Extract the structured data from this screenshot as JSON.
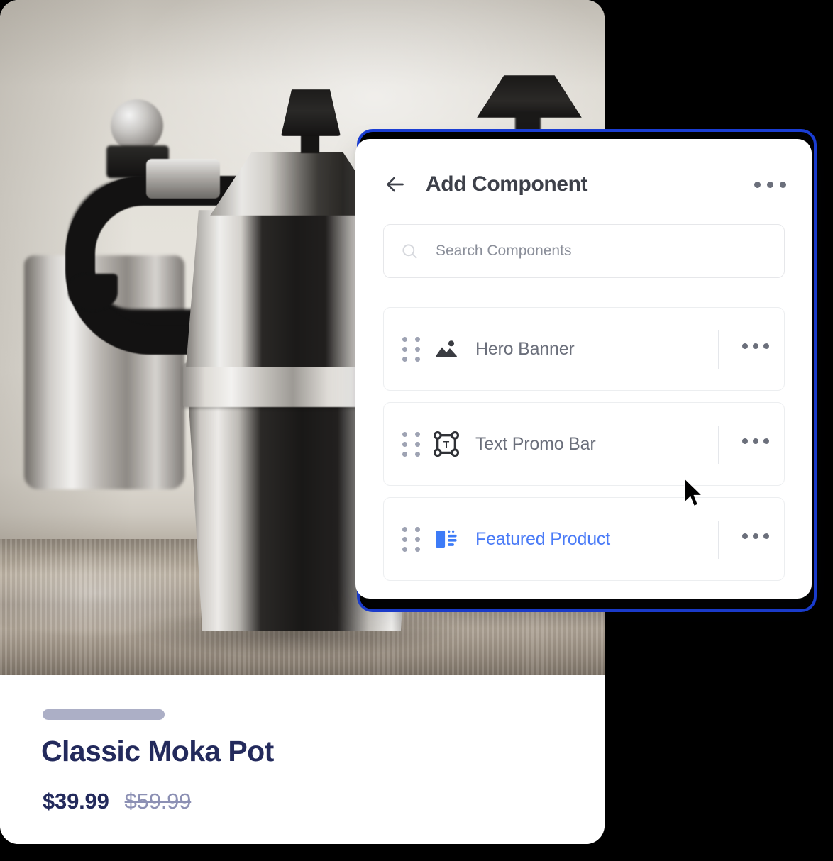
{
  "product_card": {
    "photo_alt": "Classic stovetop moka pot on a kitchen counter",
    "placeholder_bar": "",
    "title": "Classic Moka Pot",
    "price_current": "$39.99",
    "price_original": "$59.99"
  },
  "panel": {
    "back_icon": "arrow-left-icon",
    "title": "Add Component",
    "overflow_icon": "more-horizontal-icon",
    "search": {
      "icon": "search-icon",
      "value": "",
      "placeholder": "Search Components"
    },
    "components": [
      {
        "label": "Hero Banner",
        "icon": "image-icon",
        "active": false,
        "drag_handle": "drag-handle-icon",
        "overflow_icon": "more-horizontal-icon"
      },
      {
        "label": "Text Promo Bar",
        "icon": "text-frame-icon",
        "active": false,
        "drag_handle": "drag-handle-icon",
        "overflow_icon": "more-horizontal-icon"
      },
      {
        "label": "Featured Product",
        "icon": "featured-product-icon",
        "active": true,
        "drag_handle": "drag-handle-icon",
        "overflow_icon": "more-horizontal-icon"
      }
    ]
  },
  "selection": {
    "outline_color": "#1b3ed6"
  },
  "cursor": {
    "icon": "mouse-pointer-icon"
  },
  "colors": {
    "accent_blue": "#4a7bf7",
    "selection_blue": "#1b3ed6",
    "title_navy": "#232a5c",
    "muted_text": "#6b6f7b",
    "strikethrough": "#8c90b4",
    "placeholder_pill": "#acafc6"
  }
}
